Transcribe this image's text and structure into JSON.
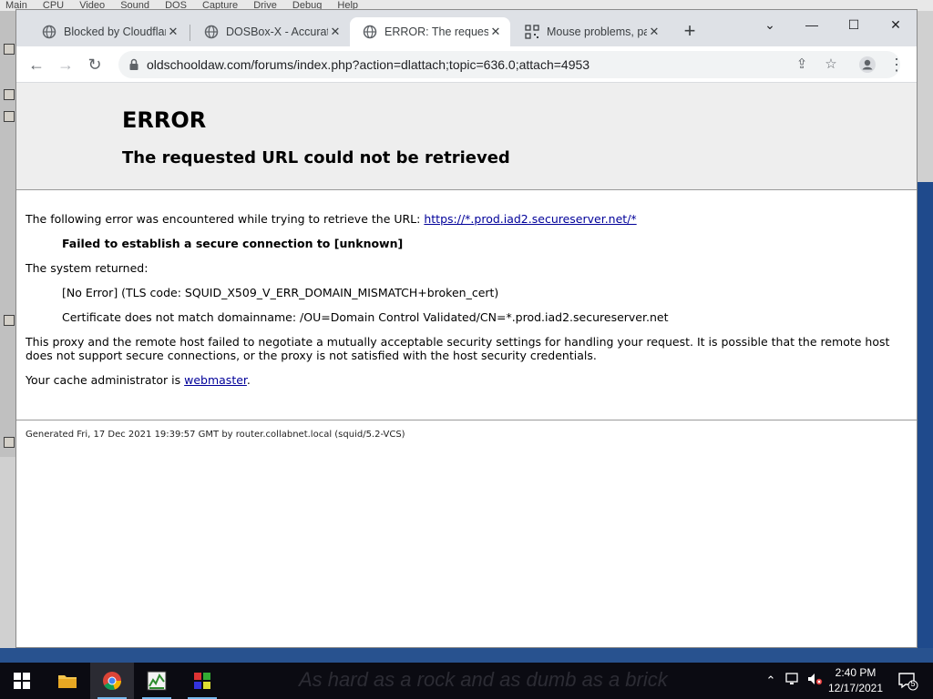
{
  "desktop": {
    "menubar_items": [
      "Main",
      "CPU",
      "Video",
      "Sound",
      "DOS",
      "Capture",
      "Drive",
      "Debug",
      "Help"
    ]
  },
  "browser": {
    "tabs": [
      {
        "title": "Blocked by Cloudflare",
        "icon": "globe-icon",
        "active": false
      },
      {
        "title": "DOSBox-X - Accurate",
        "icon": "globe-icon",
        "active": false
      },
      {
        "title": "ERROR: The requested URL could not be retrieved",
        "icon": "globe-icon",
        "active": true
      },
      {
        "title": "Mouse problems, page",
        "icon": "qr-favicon-icon",
        "active": false
      }
    ],
    "url": "oldschooldaw.com/forums/index.php?action=dlattach;topic=636.0;attach=4953"
  },
  "page": {
    "heading": "ERROR",
    "subheading": "The requested URL could not be retrieved",
    "intro_text": "The following error was encountered while trying to retrieve the URL:",
    "intro_link": "https://*.prod.iad2.secureserver.net/*",
    "error_bold": "Failed to establish a secure connection to [unknown]",
    "system_returned": "The system returned:",
    "no_error": "[No Error] (TLS code: SQUID_X509_V_ERR_DOMAIN_MISMATCH+broken_cert)",
    "cert_msg": "Certificate does not match domainname: /OU=Domain Control Validated/CN=*.prod.iad2.secureserver.net",
    "proxy_msg": "This proxy and the remote host failed to negotiate a mutually acceptable security settings for handling your request. It is possible that the remote host does not support secure connections, or the proxy is not satisfied with the host security credentials.",
    "cache_admin_prefix": "Your cache administrator is ",
    "cache_admin_link": "webmaster",
    "cache_admin_suffix": ".",
    "footer": "Generated Fri, 17 Dec 2021 19:39:57 GMT by router.collabnet.local (squid/5.2-VCS)"
  },
  "taskbar": {
    "motd": "As hard as a rock and as dumb as a brick",
    "time": "2:40 PM",
    "date": "12/17/2021",
    "notification_count": "5",
    "apps": [
      "start-button",
      "file-explorer",
      "chrome",
      "audio-app",
      "dosbox-app"
    ]
  }
}
